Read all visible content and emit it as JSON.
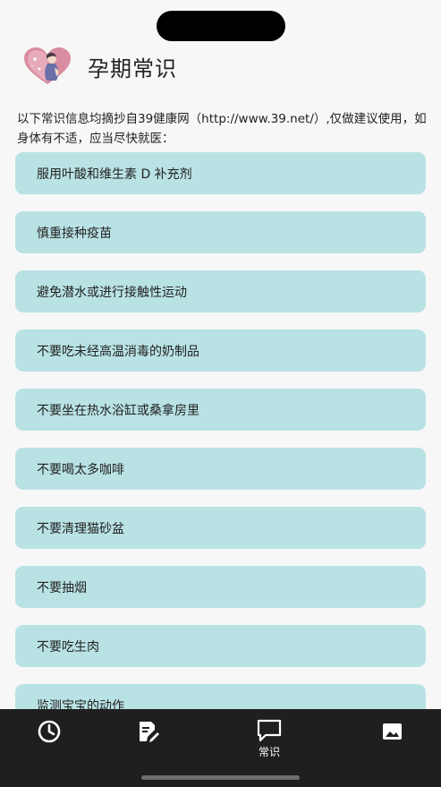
{
  "header": {
    "title": "孕期常识"
  },
  "intro": "以下常识信息均摘抄自39健康网（http://www.39.net/）,仅做建议使用，如身体有不适，应当尽快就医：",
  "items": [
    {
      "label": "服用叶酸和维生素 D 补充剂"
    },
    {
      "label": "慎重接种疫苗"
    },
    {
      "label": "避免潜水或进行接触性运动"
    },
    {
      "label": "不要吃未经高温消毒的奶制品"
    },
    {
      "label": "不要坐在热水浴缸或桑拿房里"
    },
    {
      "label": "不要喝太多咖啡"
    },
    {
      "label": "不要清理猫砂盆"
    },
    {
      "label": "不要抽烟"
    },
    {
      "label": "不要吃生肉"
    },
    {
      "label": "监测宝宝的动作"
    }
  ],
  "nav": {
    "items": [
      {
        "icon": "clock-icon",
        "label": ""
      },
      {
        "icon": "edit-note-icon",
        "label": ""
      },
      {
        "icon": "chat-bubble-icon",
        "label": "常识"
      },
      {
        "icon": "image-icon",
        "label": ""
      }
    ],
    "active_index": 2
  },
  "colors": {
    "card_background": "#b9e2e4",
    "page_background": "#f7f7f7",
    "navbar_background": "#1f1f1f",
    "logo_heart": "#d98ca0"
  }
}
